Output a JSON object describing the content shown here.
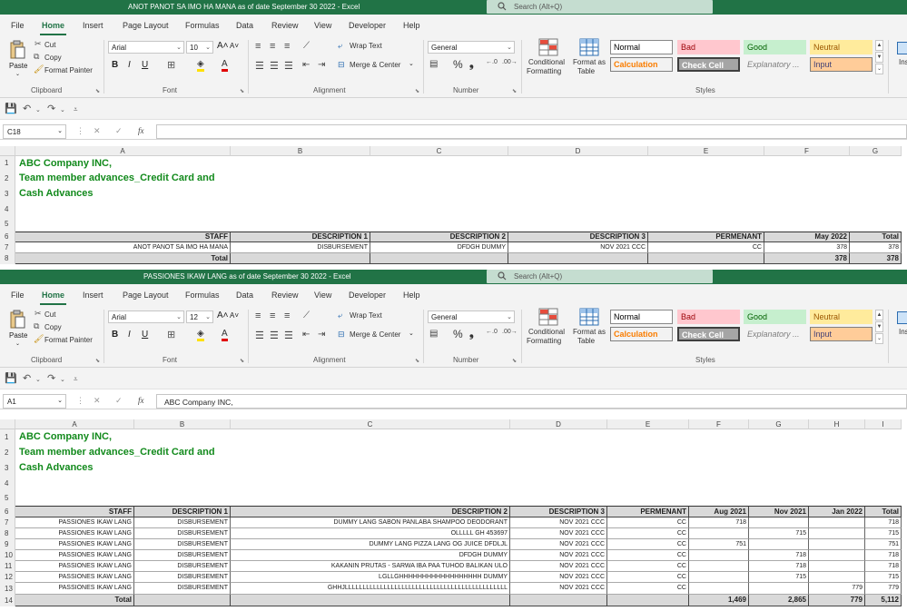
{
  "colors": {
    "titlebar": "#217346",
    "accent_green": "#128a1c",
    "header_fill": "#d9d9d9"
  },
  "window1": {
    "title": "ANOT PANOT SA IMO HA MANA  as of date September 30 2022  -  Excel",
    "search_placeholder": "Search (Alt+Q)",
    "menu": [
      "File",
      "Home",
      "Insert",
      "Page Layout",
      "Formulas",
      "Data",
      "Review",
      "View",
      "Developer",
      "Help"
    ],
    "ribbon": {
      "paste": "Paste",
      "cut": "Cut",
      "copy": "Copy",
      "format_painter": "Format Painter",
      "clipboard": "Clipboard",
      "font_name": "Arial",
      "font_size": "10",
      "font": "Font",
      "wrap_text": "Wrap Text",
      "merge_center": "Merge & Center",
      "alignment": "Alignment",
      "number_format": "General",
      "number": "Number",
      "conditional": "Conditional",
      "formatting": "Formatting",
      "format_as": "Format as",
      "table": "Table",
      "styles": "Styles",
      "style_normal": "Normal",
      "style_bad": "Bad",
      "style_good": "Good",
      "style_neutral": "Neutral",
      "style_calculation": "Calculation",
      "style_check_cell": "Check Cell",
      "style_explanatory": "Explanatory ...",
      "style_input": "Input",
      "ins": "Ins"
    },
    "name_box": "C18",
    "formula": "",
    "columns": [
      "A",
      "B",
      "C",
      "D",
      "E",
      "F",
      "G"
    ],
    "rows": [
      "1",
      "2",
      "3",
      "4",
      "5",
      "6",
      "7",
      "8"
    ],
    "heading1": "ABC Company INC,",
    "heading2": "Team member advances_Credit Card and",
    "heading3": "Cash Advances",
    "table_headers": [
      "STAFF",
      "DESCRIPTION 1",
      "DESCRIPTION 2",
      "DESCRIPTION 3",
      "PERMENANT",
      "May 2022",
      "Total"
    ],
    "table_rows": [
      [
        "ANOT PANOT SA IMO HA MANA",
        "DISBURSEMENT",
        "DFDGH DUMMY",
        "NOV 2021 CCC",
        "CC",
        "378",
        "378"
      ]
    ],
    "total_row": [
      "Total",
      "",
      "",
      "",
      "",
      "378",
      "378"
    ]
  },
  "window2": {
    "title": "PASSIONES IKAW LANG as of date September 30 2022  -  Excel",
    "search_placeholder": "Search (Alt+Q)",
    "menu": [
      "File",
      "Home",
      "Insert",
      "Page Layout",
      "Formulas",
      "Data",
      "Review",
      "View",
      "Developer",
      "Help"
    ],
    "ribbon": {
      "paste": "Paste",
      "cut": "Cut",
      "copy": "Copy",
      "format_painter": "Format Painter",
      "clipboard": "Clipboard",
      "font_name": "Arial",
      "font_size": "12",
      "font": "Font",
      "wrap_text": "Wrap Text",
      "merge_center": "Merge & Center",
      "alignment": "Alignment",
      "number_format": "General",
      "number": "Number",
      "conditional": "Conditional",
      "formatting": "Formatting",
      "format_as": "Format as",
      "table": "Table",
      "styles": "Styles",
      "style_normal": "Normal",
      "style_bad": "Bad",
      "style_good": "Good",
      "style_neutral": "Neutral",
      "style_calculation": "Calculation",
      "style_check_cell": "Check Cell",
      "style_explanatory": "Explanatory ...",
      "style_input": "Input",
      "ins": "Ins"
    },
    "name_box": "A1",
    "formula": "ABC Company INC,",
    "columns": [
      "A",
      "B",
      "C",
      "D",
      "E",
      "F",
      "G",
      "H",
      "I"
    ],
    "rows": [
      "1",
      "2",
      "3",
      "4",
      "5",
      "6",
      "7",
      "8",
      "9",
      "10",
      "11",
      "12",
      "13",
      "14"
    ],
    "heading1": "ABC Company INC,",
    "heading2": "Team member advances_Credit Card and",
    "heading3": "Cash Advances",
    "table_headers": [
      "STAFF",
      "DESCRIPTION 1",
      "DESCRIPTION 2",
      "DESCRIPTION 3",
      "PERMENANT",
      "Aug 2021",
      "Nov 2021",
      "Jan 2022",
      "Total"
    ],
    "table_rows": [
      [
        "PASSIONES IKAW LANG",
        "DISBURSEMENT",
        "DUMMY LANG SABON PANLABA SHAMPOO DEODORANT",
        "NOV 2021 CCC",
        "CC",
        "718",
        "",
        "",
        "718"
      ],
      [
        "PASSIONES IKAW LANG",
        "DISBURSEMENT",
        "OLLLLL GH 453697",
        "NOV 2021 CCC",
        "CC",
        "",
        "715",
        "",
        "715"
      ],
      [
        "PASSIONES IKAW LANG",
        "DISBURSEMENT",
        "DUMMY LANG PIZZA LANG OG JUICE DFDLJL",
        "NOV 2021 CCC",
        "CC",
        "751",
        "",
        "",
        "751"
      ],
      [
        "PASSIONES IKAW LANG",
        "DISBURSEMENT",
        "DFDGH DUMMY",
        "NOV 2021 CCC",
        "CC",
        "",
        "718",
        "",
        "718"
      ],
      [
        "PASSIONES IKAW LANG",
        "DISBURSEMENT",
        "KAKANIN PRUTAS - SARWA IBA PAA TUHOD BALIKAN ULO",
        "NOV 2021 CCC",
        "CC",
        "",
        "718",
        "",
        "718"
      ],
      [
        "PASSIONES IKAW LANG",
        "DISBURSEMENT",
        "LGLLGHHHHHHHHHHHHHHHHHH DUMMY",
        "NOV 2021 CCC",
        "CC",
        "",
        "715",
        "",
        "715"
      ],
      [
        "PASSIONES IKAW LANG",
        "DISBURSEMENT",
        "GHHJLLLLLLLLLLLLLLLLLLLLLLLLLLLLLLLLLLLLLLLLLLLLLL",
        "NOV 2021 CCC",
        "CC",
        "",
        "",
        "779",
        "779"
      ]
    ],
    "total_row": [
      "Total",
      "",
      "",
      "",
      "",
      "1,469",
      "2,865",
      "779",
      "5,112"
    ]
  }
}
